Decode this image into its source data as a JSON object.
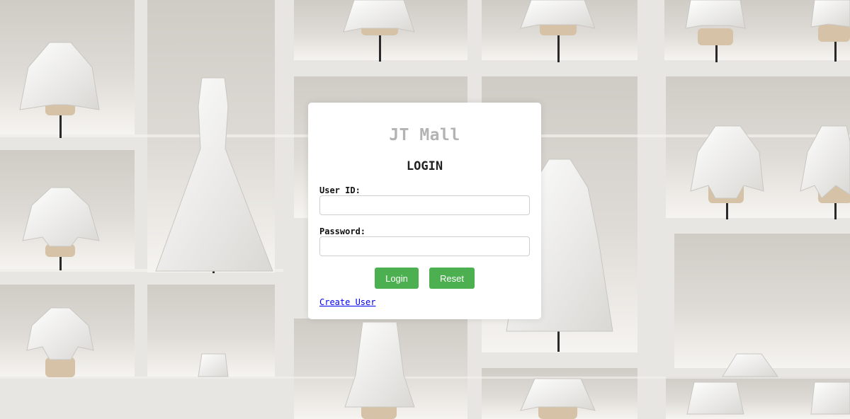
{
  "login": {
    "brand": "JT Mall",
    "heading": "LOGIN",
    "user_id_label": "User ID:",
    "user_id_value": "",
    "password_label": "Password:",
    "password_value": "",
    "login_button": "Login",
    "reset_button": "Reset",
    "create_user_link": "Create User"
  },
  "colors": {
    "button": "#4caf50",
    "link": "#0000ee",
    "brand": "#b3b3b3",
    "wall": "#e9e7e3"
  }
}
